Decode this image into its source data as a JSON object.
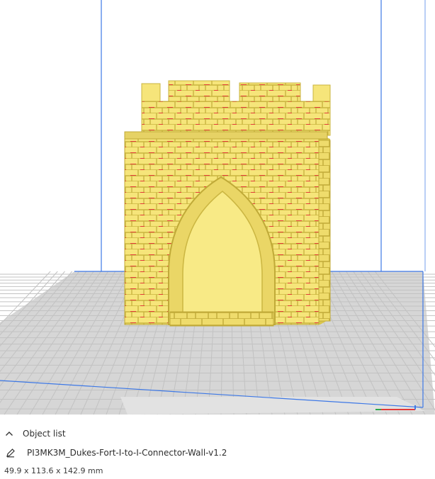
{
  "object_list": {
    "toggle_icon": "chevron-up-icon",
    "label": "Object list",
    "edit_icon": "pencil-icon",
    "object_name": "PI3MK3M_Dukes-Fort-I-to-I-Connector-Wall-v1.2",
    "dimensions": "49.9 x 113.6 x 142.9 mm"
  },
  "colors": {
    "build_plate": "#d6d6d6",
    "grid_line": "#c2c2c2",
    "volume_edge": "#3d78e6",
    "model": "#f6e57a",
    "model_shadow": "#d9c54c",
    "overhang": "#e23a3a"
  }
}
